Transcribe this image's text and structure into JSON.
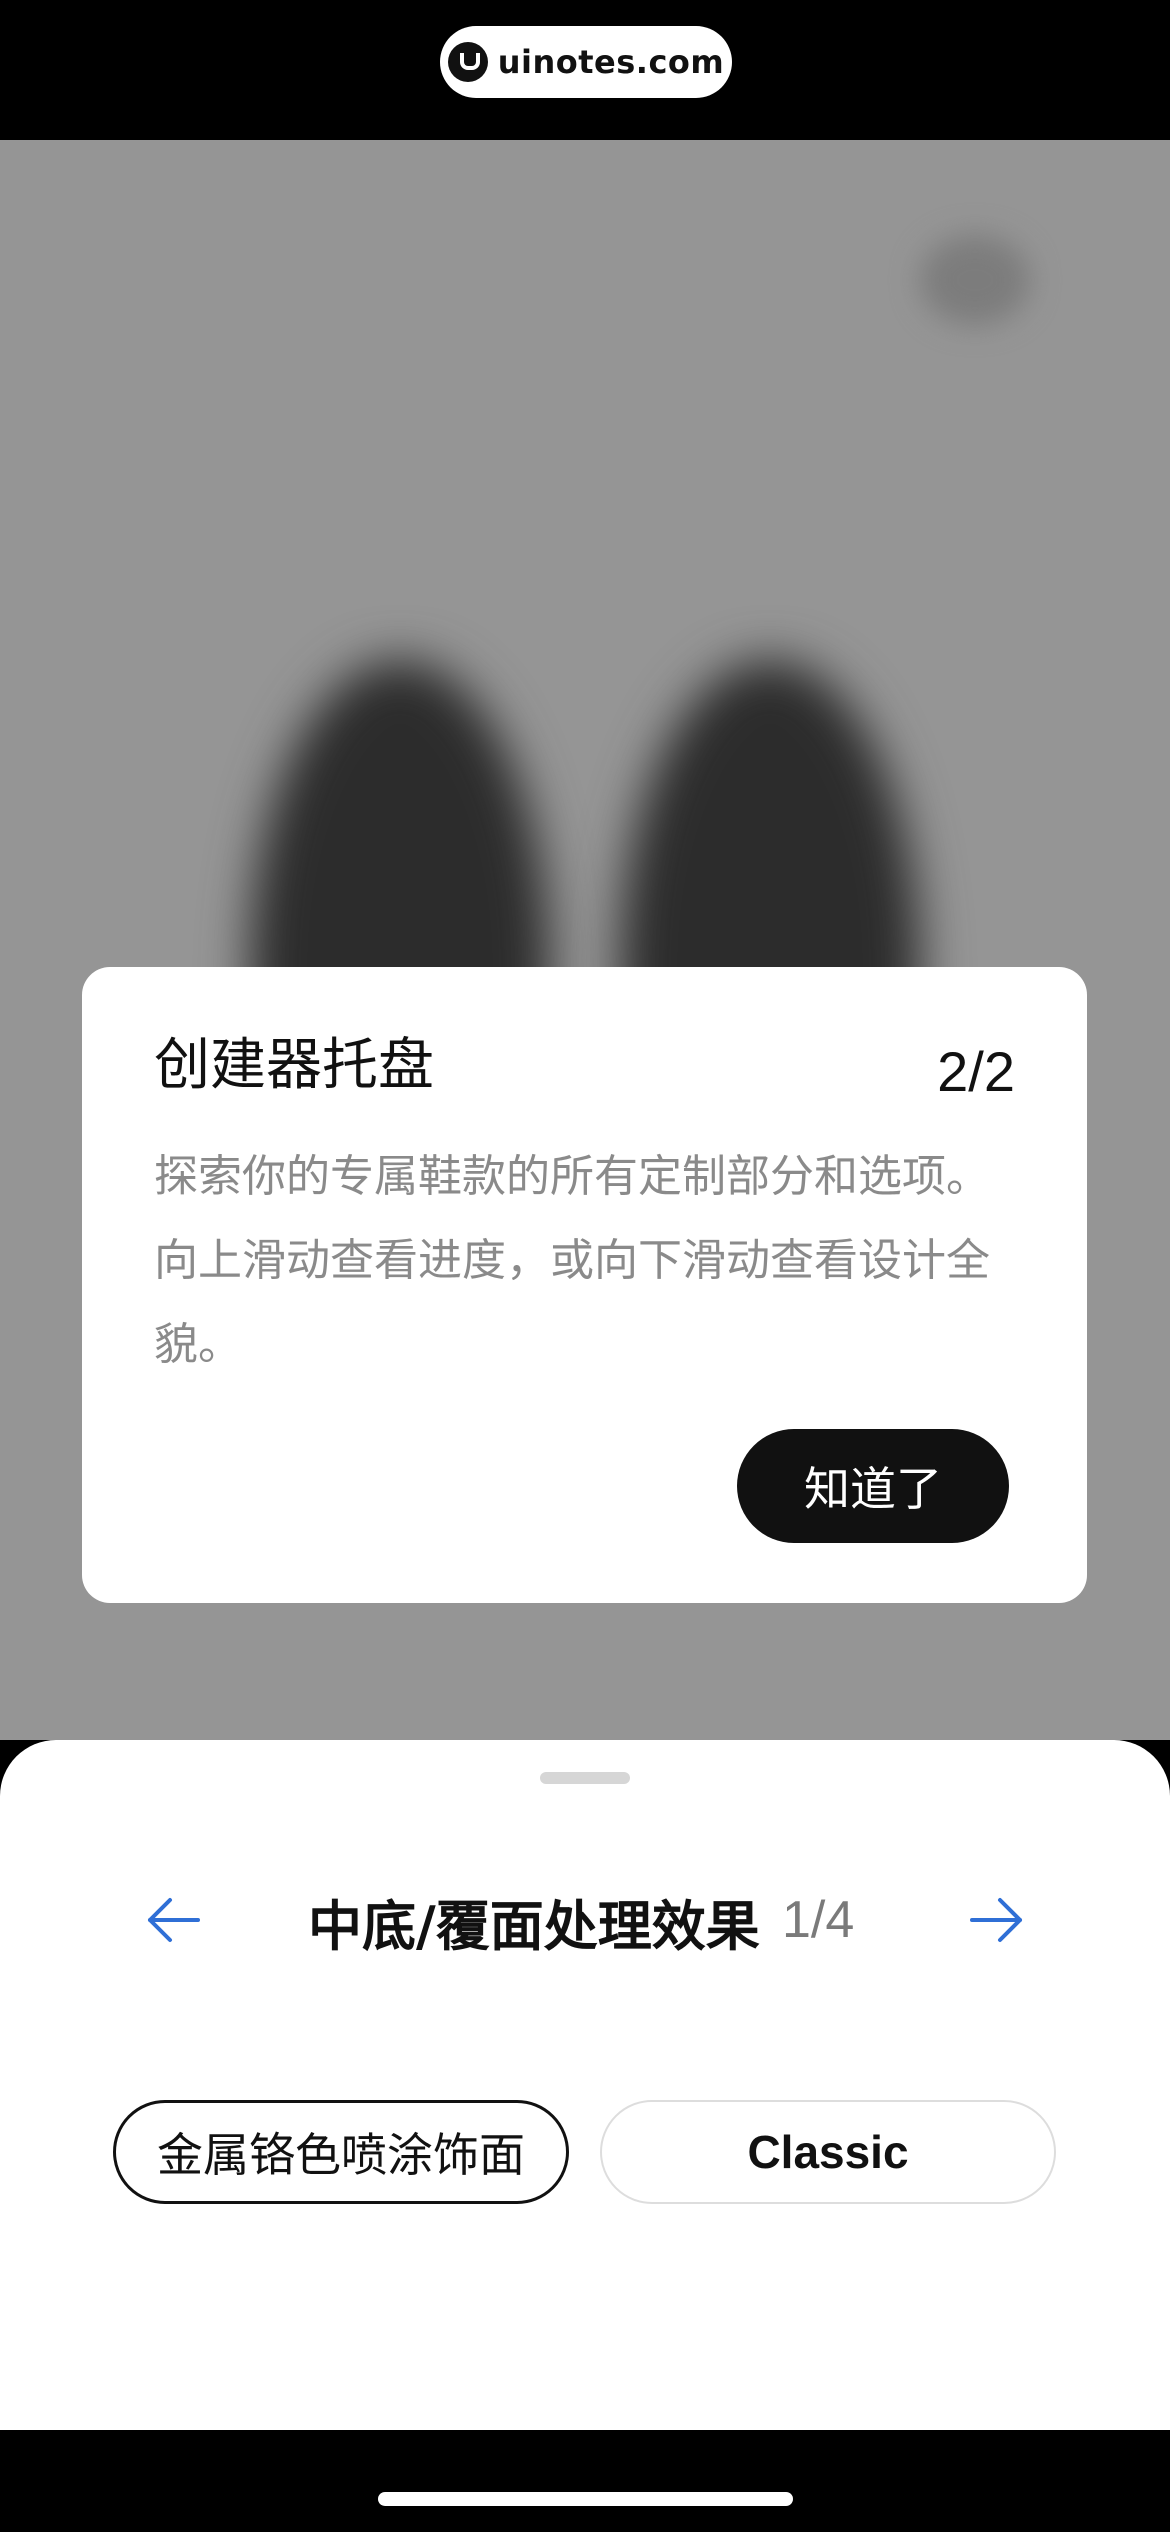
{
  "watermark": {
    "text": "uinotes.com"
  },
  "tooltip": {
    "title": "创建器托盘",
    "counter": "2/2",
    "body": "探索你的专属鞋款的所有定制部分和选项。向上滑动查看进度，或向下滑动查看设计全貌。",
    "button_label": "知道了"
  },
  "sheet": {
    "section_title": "中底/覆面处理效果",
    "section_counter": "1/4",
    "prev_icon": "arrow-left-icon",
    "next_icon": "arrow-right-icon",
    "options": [
      {
        "label": "金属铬色喷涂饰面",
        "selected": true
      },
      {
        "label": "Classic",
        "selected": false
      }
    ]
  },
  "colors": {
    "accent": "#2f6fd6",
    "overlay_gray": "#959595",
    "primary_button": "#111111"
  }
}
